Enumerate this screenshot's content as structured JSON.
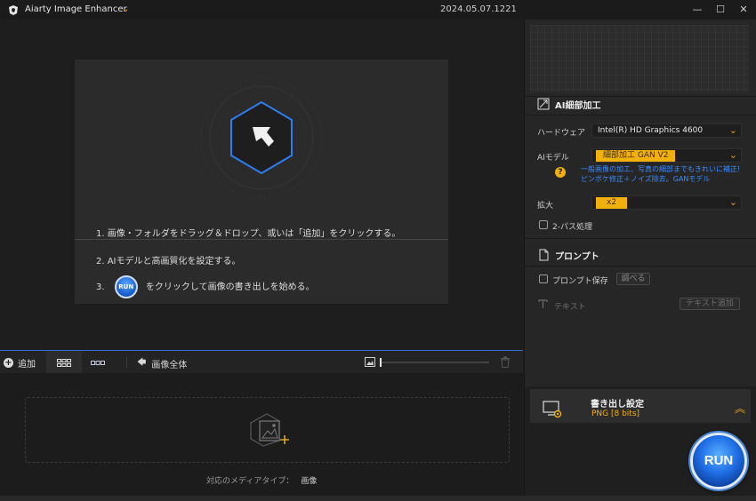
{
  "titlebar": {
    "app_title": "Aiarty Image Enhancer",
    "version": "2024.05.07.1221",
    "minimize": "—",
    "maximize": "☐",
    "close": "✕"
  },
  "guide": {
    "step1": "1.  画像・フォルダをドラッグ＆ドロップ、或いは「追加」をクリックする。",
    "step2": "2.  AIモデルと高画質化を設定する。",
    "step3_prefix": "3.",
    "step3_run": "RUN",
    "step3_suffix": "をクリックして画像の書き出しを始める。"
  },
  "toolbar": {
    "add_label": "追加",
    "full_image_label": "画像全体"
  },
  "filelist": {
    "media_type_label": "対応のメディアタイプ：",
    "media_type_value": "画像"
  },
  "panel": {
    "ai_detail": {
      "title": "AI細部加工",
      "hardware_label": "ハードウェア",
      "hardware_value": "Intel(R) HD Graphics 4600",
      "model_label": "AIモデル",
      "model_value": "細部加工 GAN V2",
      "model_desc_1": "一般画像の加工、写真の細部までもきれいに補正!",
      "model_desc_2": "ピンボケ修正＋ノイズ除去。GANモデル",
      "scale_label": "拡大",
      "scale_value": "x2",
      "twopass_label": "2-パス処理"
    },
    "prompt": {
      "title": "プロンプト",
      "save_label": "プロンプト保存",
      "lookup_label": "調べる",
      "text_label": "テキスト",
      "add_text_label": "テキスト追加"
    }
  },
  "export": {
    "title": "書き出し設定",
    "format": "PNG  [8 bits]",
    "run_label": "RUN"
  },
  "colors": {
    "accent_blue": "#2f6fd6",
    "accent_yellow": "#f2b00a"
  }
}
